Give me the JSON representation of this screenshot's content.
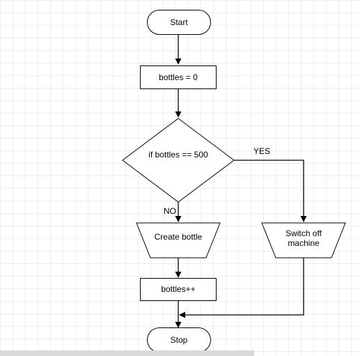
{
  "flow": {
    "start": "Start",
    "init": "bottles = 0",
    "decision": "if bottles == 500",
    "decision_no": "NO",
    "decision_yes": "YES",
    "create": "Create bottle",
    "switch_off_l1": "Switch off",
    "switch_off_l2": "machine",
    "increment": "bottles++",
    "stop": "Stop"
  }
}
